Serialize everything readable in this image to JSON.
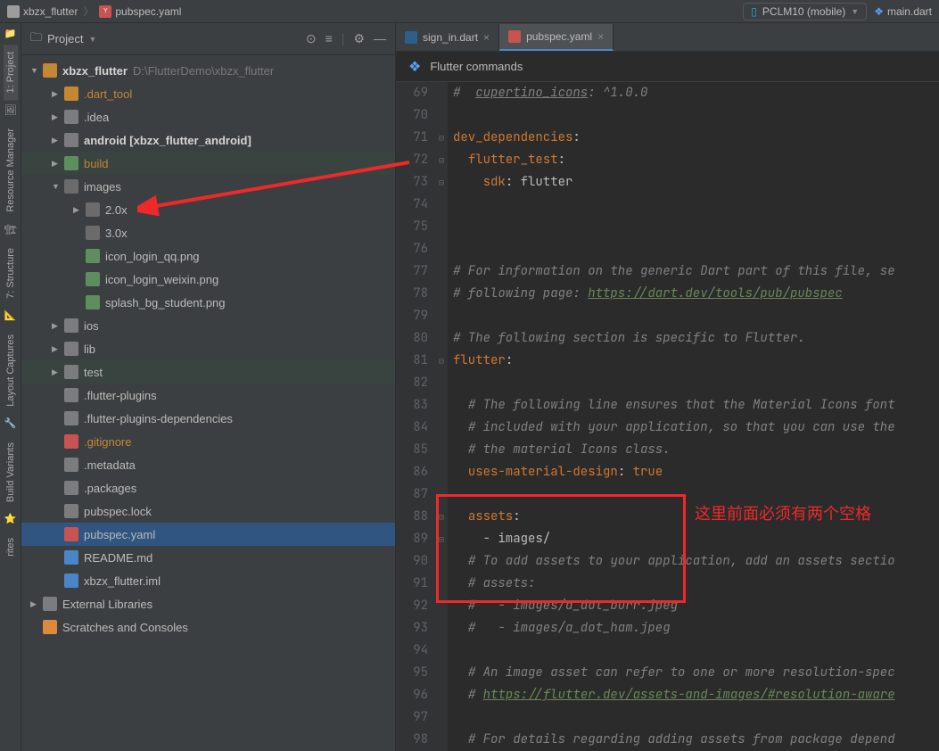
{
  "breadcrumb": {
    "proj": "xbzx_flutter",
    "file": "pubspec.yaml"
  },
  "top": {
    "device": "PCLM10 (mobile)",
    "mainfile": "main.dart"
  },
  "panel": {
    "title": "Project"
  },
  "tree": [
    {
      "indent": 0,
      "arrow": "▼",
      "icon": "folder-open",
      "label": "xbzx_flutter",
      "hint": "D:\\FlutterDemo\\xbzx_flutter",
      "bold": true
    },
    {
      "indent": 1,
      "arrow": "▶",
      "icon": "folder-orange",
      "label": ".dart_tool",
      "orange": true
    },
    {
      "indent": 1,
      "arrow": "▶",
      "icon": "folder-gray",
      "label": ".idea"
    },
    {
      "indent": 1,
      "arrow": "▶",
      "icon": "folder-gray",
      "label": "android [xbzx_flutter_android]",
      "bold": true
    },
    {
      "indent": 1,
      "arrow": "▶",
      "icon": "gear-i",
      "label": "build",
      "orange": true,
      "filematch": true
    },
    {
      "indent": 1,
      "arrow": "▼",
      "icon": "folder-dark",
      "label": "images"
    },
    {
      "indent": 2,
      "arrow": "▶",
      "icon": "folder-dark",
      "label": "2.0x"
    },
    {
      "indent": 2,
      "arrow": "",
      "icon": "folder-dark",
      "label": "3.0x"
    },
    {
      "indent": 2,
      "arrow": "",
      "icon": "file-img",
      "label": "icon_login_qq.png"
    },
    {
      "indent": 2,
      "arrow": "",
      "icon": "file-img",
      "label": "icon_login_weixin.png"
    },
    {
      "indent": 2,
      "arrow": "",
      "icon": "file-img",
      "label": "splash_bg_student.png"
    },
    {
      "indent": 1,
      "arrow": "▶",
      "icon": "folder-gray",
      "label": "ios"
    },
    {
      "indent": 1,
      "arrow": "▶",
      "icon": "folder-gray",
      "label": "lib"
    },
    {
      "indent": 1,
      "arrow": "▶",
      "icon": "folder-gray",
      "label": "test",
      "filematch": true
    },
    {
      "indent": 1,
      "arrow": "",
      "icon": "file-plain",
      "label": ".flutter-plugins"
    },
    {
      "indent": 1,
      "arrow": "",
      "icon": "file-plain",
      "label": ".flutter-plugins-dependencies"
    },
    {
      "indent": 1,
      "arrow": "",
      "icon": "file-git",
      "label": ".gitignore",
      "orange": true
    },
    {
      "indent": 1,
      "arrow": "",
      "icon": "file-plain",
      "label": ".metadata"
    },
    {
      "indent": 1,
      "arrow": "",
      "icon": "file-plain",
      "label": ".packages"
    },
    {
      "indent": 1,
      "arrow": "",
      "icon": "file-plain",
      "label": "pubspec.lock"
    },
    {
      "indent": 1,
      "arrow": "",
      "icon": "file-yml",
      "label": "pubspec.yaml",
      "selected": true
    },
    {
      "indent": 1,
      "arrow": "",
      "icon": "file-md",
      "label": "README.md"
    },
    {
      "indent": 1,
      "arrow": "",
      "icon": "file-iml",
      "label": "xbzx_flutter.iml"
    },
    {
      "indent": 0,
      "arrow": "▶",
      "icon": "lib-i",
      "label": "External Libraries"
    },
    {
      "indent": 0,
      "arrow": "",
      "icon": "clock-i",
      "label": "Scratches and Consoles"
    }
  ],
  "tabs": [
    {
      "icon": "dart-i",
      "label": "sign_in.dart",
      "active": false
    },
    {
      "icon": "yml-i",
      "label": "pubspec.yaml",
      "active": true
    }
  ],
  "fluttercmd": "Flutter commands",
  "code": {
    "start": 69,
    "lines": [
      {
        "fold": "",
        "html": "<span class='c-com'>#  <span class='c-underline'>cupertino_icons</span>: ^1.0.0</span>"
      },
      {
        "fold": "",
        "html": ""
      },
      {
        "fold": "⊟",
        "html": "<span class='c-key'>dev_dependencies</span>:"
      },
      {
        "fold": "⊟",
        "html": "  <span class='c-key'>flutter_test</span>:"
      },
      {
        "fold": "⊟",
        "html": "    <span class='c-key'>sdk</span>: flutter"
      },
      {
        "fold": "",
        "html": ""
      },
      {
        "fold": "",
        "html": ""
      },
      {
        "fold": "",
        "html": ""
      },
      {
        "fold": "",
        "html": "<span class='c-com'># For information on the generic Dart part of this file, se</span>"
      },
      {
        "fold": "",
        "html": "<span class='c-com'># following page: </span><span class='c-link'>https://dart.dev/tools/pub/pubspec</span>"
      },
      {
        "fold": "",
        "html": ""
      },
      {
        "fold": "",
        "html": "<span class='c-com'># The following section is specific to Flutter.</span>"
      },
      {
        "fold": "⊟",
        "html": "<span class='c-key'>flutter</span>:"
      },
      {
        "fold": "",
        "html": ""
      },
      {
        "fold": "",
        "html": "  <span class='c-com'># The following line ensures that the Material Icons font</span>"
      },
      {
        "fold": "",
        "html": "  <span class='c-com'># included with your application, so that you can use the</span>"
      },
      {
        "fold": "",
        "html": "  <span class='c-com'># the material Icons class.</span>"
      },
      {
        "fold": "",
        "html": "  <span class='c-key'>uses-material-design</span>: <span class='c-key'>true</span>"
      },
      {
        "fold": "",
        "html": ""
      },
      {
        "fold": "⊟",
        "html": "  <span class='c-key'>assets</span>:"
      },
      {
        "fold": "⊟",
        "html": "    - images/"
      },
      {
        "fold": "",
        "html": "  <span class='c-com'># To add assets to your application, add an assets sectio</span>"
      },
      {
        "fold": "",
        "html": "  <span class='c-com'># assets:</span>"
      },
      {
        "fold": "",
        "html": "  <span class='c-com'>#   - images/a_dot_burr.jpeg</span>"
      },
      {
        "fold": "",
        "html": "  <span class='c-com'>#   - images/a_dot_ham.jpeg</span>"
      },
      {
        "fold": "",
        "html": ""
      },
      {
        "fold": "",
        "html": "  <span class='c-com'># An image asset can refer to one or more resolution-spec</span>"
      },
      {
        "fold": "",
        "html": "  <span class='c-com'># </span><span class='c-link'>https://flutter.dev/assets-and-images/#resolution-aware</span>"
      },
      {
        "fold": "",
        "html": ""
      },
      {
        "fold": "",
        "html": "  <span class='c-com'># For details regarding adding assets from package depend</span>"
      }
    ]
  },
  "annot": {
    "text": "这里前面必须有两个空格"
  },
  "gutterTabs": [
    {
      "icon": "📁",
      "label": "1: Project",
      "active": true
    },
    {
      "icon": "🖼",
      "label": "Resource Manager"
    },
    {
      "icon": "🏗",
      "label": "7: Structure"
    },
    {
      "icon": "📐",
      "label": "Layout Captures"
    },
    {
      "icon": "🔧",
      "label": "Build Variants"
    },
    {
      "icon": "⭐",
      "label": "rites"
    }
  ]
}
